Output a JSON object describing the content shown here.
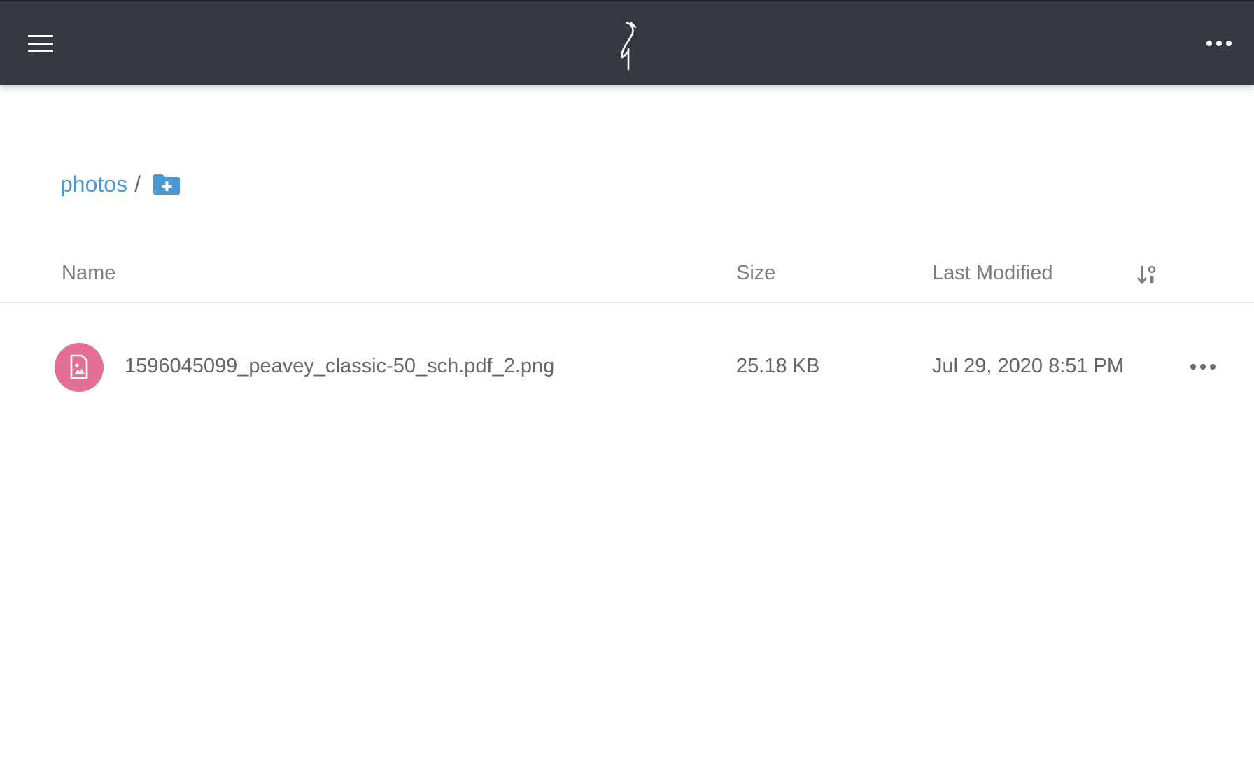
{
  "header": {
    "menu_icon": "hamburger-icon",
    "logo_icon": "minio-heron-logo",
    "more_icon": "more-horizontal-icon"
  },
  "breadcrumb": {
    "bucket": "photos",
    "separator": "/",
    "new_folder_icon": "folder-add-icon"
  },
  "table": {
    "columns": {
      "name": "Name",
      "size": "Size",
      "last_modified": "Last Modified"
    },
    "sort_icon": "sort-icon",
    "rows": [
      {
        "icon": "image-file-icon",
        "name": "1596045099_peavey_classic-50_sch.pdf_2.png",
        "size": "25.18 KB",
        "last_modified": "Jul 29, 2020 8:51 PM",
        "actions_icon": "more-horizontal-icon"
      }
    ]
  },
  "colors": {
    "topbar": "#353a42",
    "link": "#4a99d5",
    "file_icon_bg": "#e36e96"
  }
}
